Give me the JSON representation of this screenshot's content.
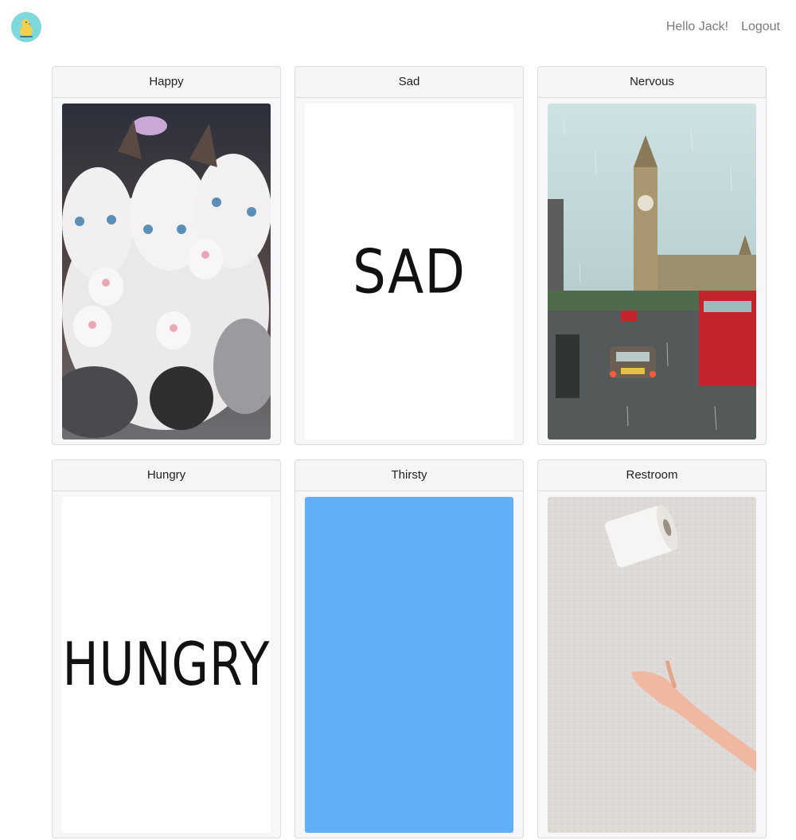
{
  "navbar": {
    "logo_icon": "duck-logo-icon",
    "greeting": "Hello Jack!",
    "logout_label": "Logout"
  },
  "cards": [
    {
      "title": "Happy",
      "image": "kittens-photo"
    },
    {
      "title": "Sad",
      "image": "sad-text-image",
      "image_text": "SAD"
    },
    {
      "title": "Nervous",
      "image": "rainy-london-photo"
    },
    {
      "title": "Hungry",
      "image": "hungry-text-image",
      "image_text": "HUNGRY"
    },
    {
      "title": "Thirsty",
      "image": "blue-image",
      "image_color": "#61aff6"
    },
    {
      "title": "Restroom",
      "image": "toilet-paper-photo"
    }
  ],
  "colors": {
    "logo_bg": "#7fd8dc",
    "thirsty_blue": "#61aff6",
    "nav_text": "#7a7a7a"
  }
}
